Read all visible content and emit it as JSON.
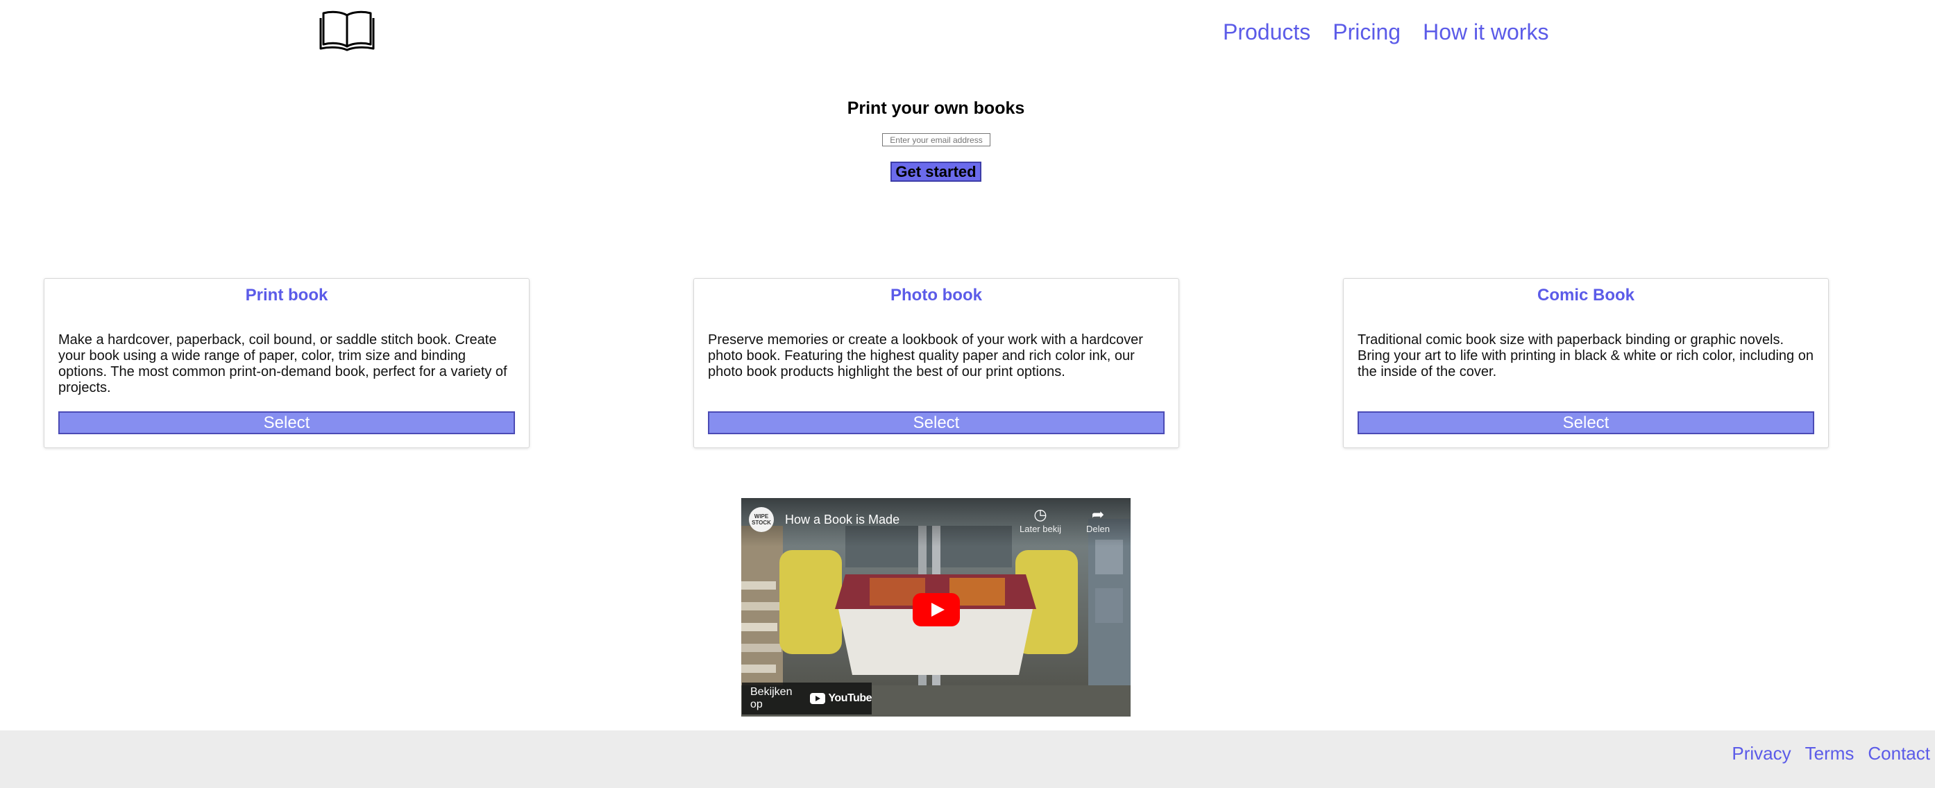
{
  "header": {
    "logo_icon": "open-book-icon",
    "nav": [
      {
        "label": "Products"
      },
      {
        "label": "Pricing"
      },
      {
        "label": "How it works"
      }
    ]
  },
  "hero": {
    "title": "Print your own books",
    "email_placeholder": "Enter your email address",
    "cta_label": "Get started"
  },
  "cards": [
    {
      "title": "Print book",
      "description": "Make a hardcover, paperback, coil bound, or saddle stitch book. Create your book using a wide range of paper, color, trim size and binding options. The most common print-on-demand book, perfect for a variety of projects.",
      "button_label": "Select"
    },
    {
      "title": "Photo book",
      "description": "Preserve memories or create a lookbook of your work with a hardcover photo book. Featuring the highest quality paper and rich color ink, our photo book products highlight the best of our print options.",
      "button_label": "Select"
    },
    {
      "title": "Comic Book",
      "description": "Traditional comic book size with paperback binding or graphic novels. Bring your art to life with printing in black & white or rich color, including on the inside of the cover.",
      "button_label": "Select"
    }
  ],
  "video": {
    "channel_avatar_text": "WIPE STOCK",
    "title": "How a Book is Made",
    "watch_later_label": "Later bekij",
    "share_label": "Delen",
    "watch_on_label": "Bekijken op",
    "youtube_label": "YouTube",
    "play_icon": "play-icon",
    "clock_icon": "clock-icon",
    "share_icon": "share-icon"
  },
  "footer": {
    "links": [
      {
        "label": "Privacy"
      },
      {
        "label": "Terms"
      },
      {
        "label": "Contact"
      }
    ]
  },
  "colors": {
    "link": "#5b5be8",
    "cta_bg": "#6b6bec",
    "card_button_bg": "#868ef0",
    "footer_bg": "#ececec",
    "youtube_red": "#ff0000"
  }
}
